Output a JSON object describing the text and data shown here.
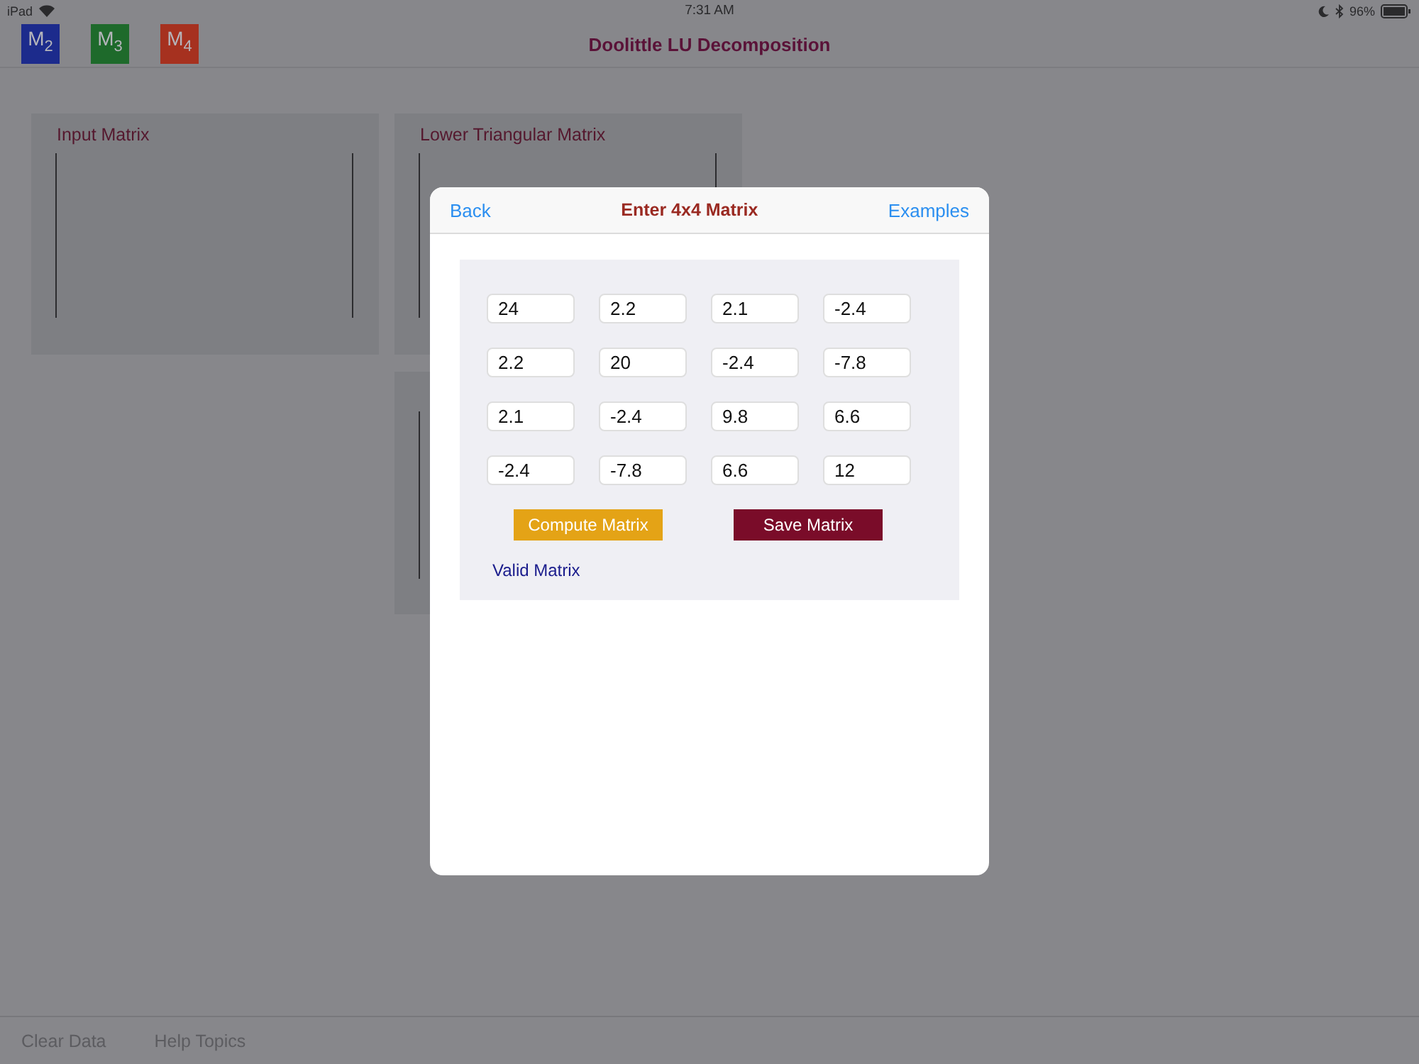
{
  "status_bar": {
    "device": "iPad",
    "time": "7:31 AM",
    "battery": "96%"
  },
  "header": {
    "title": "Doolittle LU Decomposition",
    "matrix_buttons": [
      {
        "label": "M$_{2}$",
        "color": "#1c2b8c"
      },
      {
        "label": "M$_{3}$",
        "color": "#1e6a2b"
      },
      {
        "label": "M$_{4}$",
        "color": "#a6311f"
      }
    ]
  },
  "panels": [
    {
      "title": "Input Matrix"
    },
    {
      "title": "Lower Triangular Matrix"
    }
  ],
  "dialog": {
    "back": "Back",
    "title": "Enter 4x4 Matrix",
    "examples": "Examples",
    "matrix": [
      [
        "24",
        "2.2",
        "2.1",
        "-2.4"
      ],
      [
        "2.2",
        "20",
        "-2.4",
        "-7.8"
      ],
      [
        "2.1",
        "-2.4",
        "9.8",
        "6.6"
      ],
      [
        "-2.4",
        "-7.8",
        "6.6",
        "12"
      ]
    ],
    "compute_button": "Compute Matrix",
    "save_button": "Save Matrix",
    "status": "Valid Matrix"
  },
  "toolbar": [
    "Clear Data",
    "Help Topics"
  ]
}
